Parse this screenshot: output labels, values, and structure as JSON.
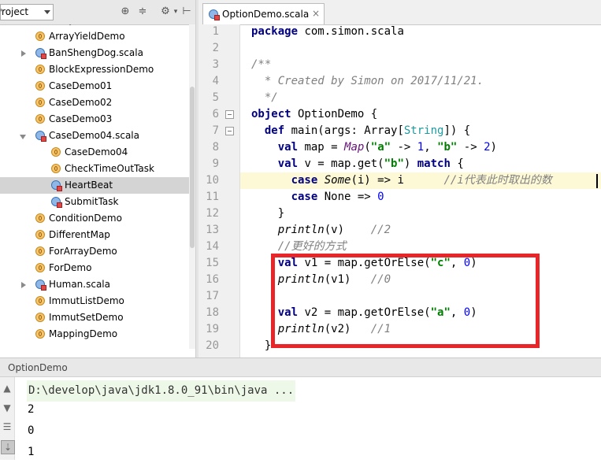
{
  "project_panel": {
    "title": "Project",
    "items": [
      {
        "label": "ArrayMain",
        "type": "object",
        "indent": 1,
        "expand": ""
      },
      {
        "label": "ArrayYieldDemo",
        "type": "object",
        "indent": 1,
        "expand": ""
      },
      {
        "label": "BanShengDog.scala",
        "type": "class",
        "indent": 1,
        "expand": "collapsed"
      },
      {
        "label": "BlockExpressionDemo",
        "type": "object",
        "indent": 1,
        "expand": ""
      },
      {
        "label": "CaseDemo01",
        "type": "object",
        "indent": 1,
        "expand": ""
      },
      {
        "label": "CaseDemo02",
        "type": "object",
        "indent": 1,
        "expand": ""
      },
      {
        "label": "CaseDemo03",
        "type": "object",
        "indent": 1,
        "expand": ""
      },
      {
        "label": "CaseDemo04.scala",
        "type": "class",
        "indent": 1,
        "expand": "expanded"
      },
      {
        "label": "CaseDemo04",
        "type": "object",
        "indent": 2,
        "expand": ""
      },
      {
        "label": "CheckTimeOutTask",
        "type": "object",
        "indent": 2,
        "expand": ""
      },
      {
        "label": "HeartBeat",
        "type": "class",
        "indent": 2,
        "expand": "",
        "selected": true
      },
      {
        "label": "SubmitTask",
        "type": "class",
        "indent": 2,
        "expand": ""
      },
      {
        "label": "ConditionDemo",
        "type": "object",
        "indent": 1,
        "expand": ""
      },
      {
        "label": "DifferentMap",
        "type": "object",
        "indent": 1,
        "expand": ""
      },
      {
        "label": "ForArrayDemo",
        "type": "object",
        "indent": 1,
        "expand": ""
      },
      {
        "label": "ForDemo",
        "type": "object",
        "indent": 1,
        "expand": ""
      },
      {
        "label": "Human.scala",
        "type": "class",
        "indent": 1,
        "expand": "collapsed"
      },
      {
        "label": "ImmutListDemo",
        "type": "object",
        "indent": 1,
        "expand": ""
      },
      {
        "label": "ImmutSetDemo",
        "type": "object",
        "indent": 1,
        "expand": ""
      },
      {
        "label": "MappingDemo",
        "type": "object",
        "indent": 1,
        "expand": ""
      }
    ],
    "toolbar_icons": [
      "target-icon",
      "collapse-all-icon",
      "settings-icon",
      "hide-panel-icon"
    ]
  },
  "editor": {
    "tab": {
      "label": "OptionDemo.scala",
      "close": "×"
    },
    "current_line": 10,
    "lines": [
      {
        "n": "1",
        "tokens": [
          [
            "k",
            "package"
          ],
          [
            "p",
            " com.simon.scala"
          ]
        ]
      },
      {
        "n": "2",
        "tokens": []
      },
      {
        "n": "3",
        "tokens": [
          [
            "c",
            "/**"
          ]
        ]
      },
      {
        "n": "4",
        "tokens": [
          [
            "c",
            "  * Created by Simon on 2017/11/21."
          ]
        ]
      },
      {
        "n": "5",
        "tokens": [
          [
            "c",
            "  */"
          ]
        ]
      },
      {
        "n": "6",
        "tokens": [
          [
            "k",
            "object"
          ],
          [
            "p",
            " OptionDemo {"
          ]
        ]
      },
      {
        "n": "7",
        "tokens": [
          [
            "p",
            "  "
          ],
          [
            "k",
            "def"
          ],
          [
            "p",
            " main(args: Array["
          ],
          [
            "ty",
            "String"
          ],
          [
            "p",
            "]) {"
          ]
        ]
      },
      {
        "n": "8",
        "tokens": [
          [
            "p",
            "    "
          ],
          [
            "k",
            "val"
          ],
          [
            "p",
            " map = "
          ],
          [
            "mp",
            "Map"
          ],
          [
            "p",
            "("
          ],
          [
            "s",
            "\"a\""
          ],
          [
            "p",
            " -> "
          ],
          [
            "n",
            "1"
          ],
          [
            "p",
            ", "
          ],
          [
            "s",
            "\"b\""
          ],
          [
            "p",
            " -> "
          ],
          [
            "n",
            "2"
          ],
          [
            "p",
            ")"
          ]
        ]
      },
      {
        "n": "9",
        "tokens": [
          [
            "p",
            "    "
          ],
          [
            "k",
            "val"
          ],
          [
            "p",
            " v = map.get("
          ],
          [
            "s",
            "\"b\""
          ],
          [
            "p",
            ") "
          ],
          [
            "k",
            "match"
          ],
          [
            "p",
            " {"
          ]
        ]
      },
      {
        "n": "10",
        "tokens": [
          [
            "p",
            "      "
          ],
          [
            "k",
            "case"
          ],
          [
            "p",
            " "
          ],
          [
            "it",
            "Some"
          ],
          [
            "p",
            "(i) => i      "
          ],
          [
            "c",
            "//i代表此时取出的数"
          ]
        ]
      },
      {
        "n": "11",
        "tokens": [
          [
            "p",
            "      "
          ],
          [
            "k",
            "case"
          ],
          [
            "p",
            " None => "
          ],
          [
            "n",
            "0"
          ]
        ]
      },
      {
        "n": "12",
        "tokens": [
          [
            "p",
            "    }"
          ]
        ]
      },
      {
        "n": "13",
        "tokens": [
          [
            "p",
            "    "
          ],
          [
            "it",
            "println"
          ],
          [
            "p",
            "(v)    "
          ],
          [
            "c",
            "//2"
          ]
        ]
      },
      {
        "n": "14",
        "tokens": [
          [
            "p",
            "    "
          ],
          [
            "c",
            "//更好的方式"
          ]
        ]
      },
      {
        "n": "15",
        "tokens": [
          [
            "p",
            "    "
          ],
          [
            "k",
            "val"
          ],
          [
            "p",
            " v1 = map.getOrElse("
          ],
          [
            "s",
            "\"c\""
          ],
          [
            "p",
            ", "
          ],
          [
            "n",
            "0"
          ],
          [
            "p",
            ")"
          ]
        ]
      },
      {
        "n": "16",
        "tokens": [
          [
            "p",
            "    "
          ],
          [
            "it",
            "println"
          ],
          [
            "p",
            "(v1)   "
          ],
          [
            "c",
            "//0"
          ]
        ]
      },
      {
        "n": "17",
        "tokens": []
      },
      {
        "n": "18",
        "tokens": [
          [
            "p",
            "    "
          ],
          [
            "k",
            "val"
          ],
          [
            "p",
            " v2 = map.getOrElse("
          ],
          [
            "s",
            "\"a\""
          ],
          [
            "p",
            ", "
          ],
          [
            "n",
            "0"
          ],
          [
            "p",
            ")"
          ]
        ]
      },
      {
        "n": "19",
        "tokens": [
          [
            "p",
            "    "
          ],
          [
            "it",
            "println"
          ],
          [
            "p",
            "(v2)   "
          ],
          [
            "c",
            "//1"
          ]
        ]
      },
      {
        "n": "20",
        "tokens": [
          [
            "p",
            "  }"
          ]
        ]
      }
    ]
  },
  "run_panel": {
    "title": "OptionDemo",
    "command": "D:\\develop\\java\\jdk1.8.0_91\\bin\\java ...",
    "output": [
      "2",
      "0",
      "1"
    ],
    "tool_icons": [
      "rerun-icon",
      "stop-icon",
      "soft-wrap-icon",
      "scroll-to-end-icon"
    ]
  },
  "colors": {
    "highlight_box": "#e8262a",
    "current_line": "#fdf9d6",
    "keyword": "#000080",
    "string": "#008000",
    "number": "#0000ff",
    "comment": "#808080"
  }
}
